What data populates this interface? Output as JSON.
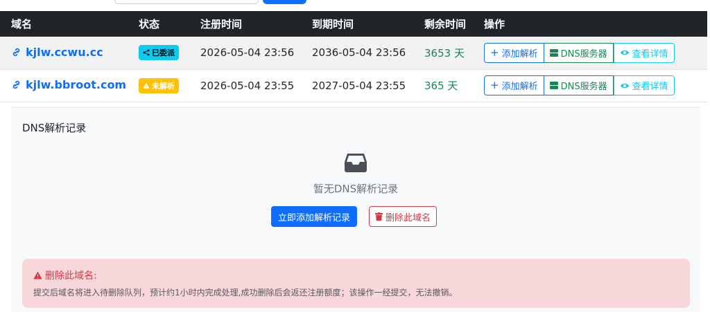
{
  "table": {
    "headers": [
      "域名",
      "状态",
      "注册时间",
      "到期时间",
      "剩余时间",
      "操作"
    ],
    "rows": [
      {
        "domain": "kjlw.ccwu.cc",
        "status": "已委派",
        "status_icon": "share-icon",
        "registered": "2026-05-04 23:56",
        "expires": "2036-05-04 23:56",
        "remaining": "3653 天"
      },
      {
        "domain": "kjlw.bbroot.com",
        "status": "未解析",
        "status_icon": "warning-icon",
        "registered": "2026-05-04 23:55",
        "expires": "2027-05-04 23:55",
        "remaining": "365 天"
      }
    ],
    "actions": {
      "add": "添加解析",
      "dns": "DNS服务器",
      "view": "查看详情"
    }
  },
  "dns_panel": {
    "title": "DNS解析记录",
    "empty_text": "暂无DNS解析记录",
    "add_record_button": "立即添加解析记录",
    "delete_domain_button": "删除此域名"
  },
  "alert": {
    "title": "删除此域名:",
    "body": "提交后域名将进入待删除队列，预计约1小时内完成处理,成功删除后会返还注册额度；该操作一经提交，无法撤销。"
  },
  "colors": {
    "primary": "#0d6efd",
    "success": "#198754",
    "info": "#0dcaf0",
    "warning": "#ffc107",
    "danger": "#dc3545",
    "header_bg": "#212529"
  }
}
